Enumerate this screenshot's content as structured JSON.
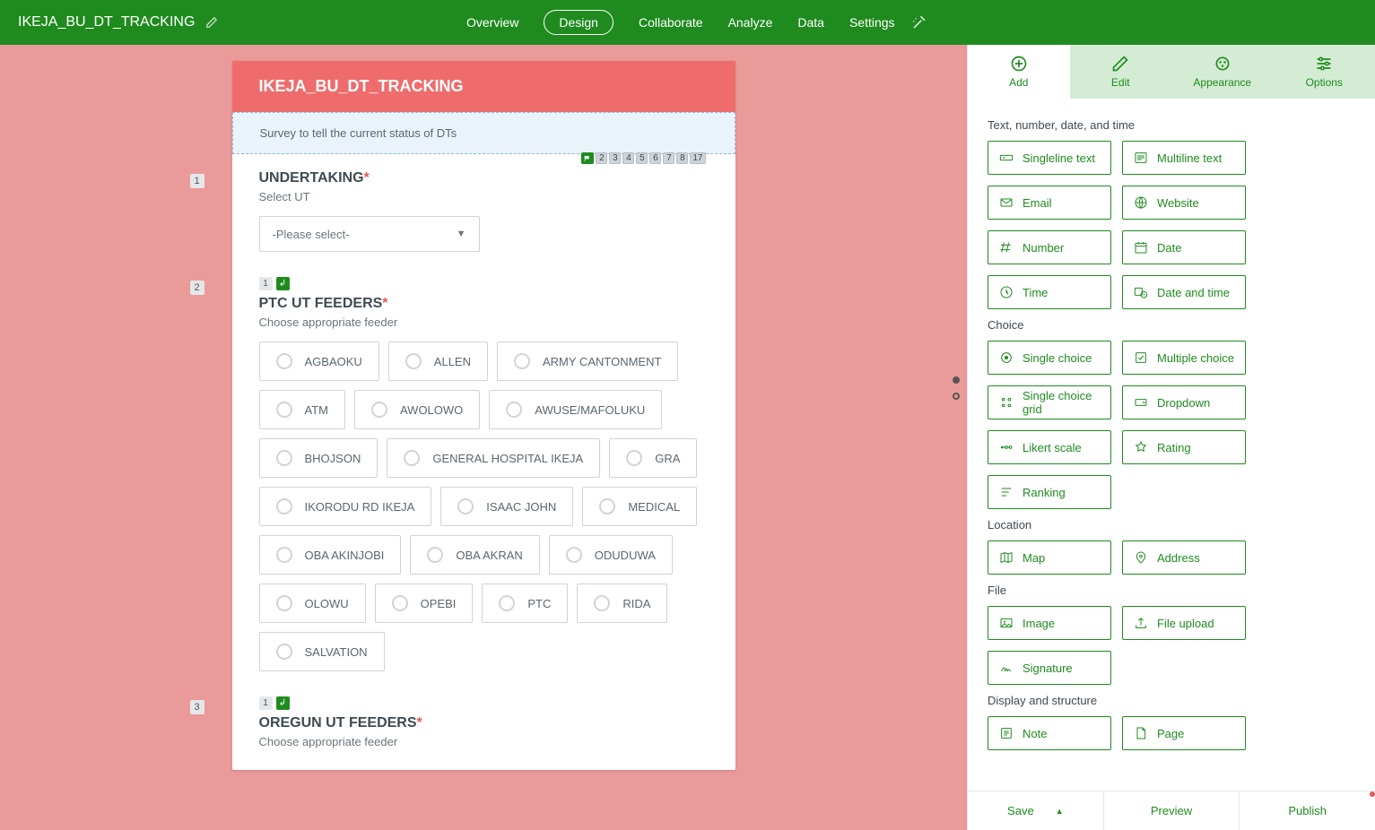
{
  "header": {
    "title": "IKEJA_BU_DT_TRACKING",
    "nav": [
      "Overview",
      "Design",
      "Collaborate",
      "Analyze",
      "Data",
      "Settings"
    ],
    "activeNav": "Design"
  },
  "form": {
    "title": "IKEJA_BU_DT_TRACKING",
    "description": "Survey to tell the current status of DTs",
    "pagePills": [
      "2",
      "3",
      "4",
      "5",
      "6",
      "7",
      "8",
      "17"
    ]
  },
  "q1": {
    "num": "1",
    "title": "UNDERTAKING",
    "sub": "Select UT",
    "placeholder": "-Please select-"
  },
  "q2": {
    "num": "2",
    "logicRef": "1",
    "title": "PTC UT FEEDERS",
    "sub": "Choose appropriate feeder",
    "options": [
      "AGBAOKU",
      "ALLEN",
      "ARMY CANTONMENT",
      "ATM",
      "AWOLOWO",
      "AWUSE/MAFOLUKU",
      "BHOJSON",
      "GENERAL HOSPITAL IKEJA",
      "GRA",
      "IKORODU RD IKEJA",
      "ISAAC JOHN",
      "MEDICAL",
      "OBA AKINJOBI",
      "OBA AKRAN",
      "ODUDUWA",
      "OLOWU",
      "OPEBI",
      "PTC",
      "RIDA",
      "SALVATION"
    ]
  },
  "q3": {
    "num": "3",
    "logicRef": "1",
    "title": "OREGUN UT FEEDERS",
    "sub": "Choose appropriate feeder"
  },
  "sidebar": {
    "tabs": [
      "Add",
      "Edit",
      "Appearance",
      "Options"
    ],
    "sections": {
      "text": {
        "label": "Text, number, date, and time",
        "items": [
          "Singleline text",
          "Multiline text",
          "Email",
          "Website",
          "Number",
          "Date",
          "Time",
          "Date and time"
        ]
      },
      "choice": {
        "label": "Choice",
        "items": [
          "Single choice",
          "Multiple choice",
          "Single choice grid",
          "Dropdown",
          "Likert scale",
          "Rating",
          "Ranking"
        ]
      },
      "location": {
        "label": "Location",
        "items": [
          "Map",
          "Address"
        ]
      },
      "file": {
        "label": "File",
        "items": [
          "Image",
          "File upload",
          "Signature"
        ]
      },
      "display": {
        "label": "Display and structure",
        "items": [
          "Note",
          "Page"
        ]
      }
    }
  },
  "footer": {
    "save": "Save",
    "preview": "Preview",
    "publish": "Publish"
  }
}
